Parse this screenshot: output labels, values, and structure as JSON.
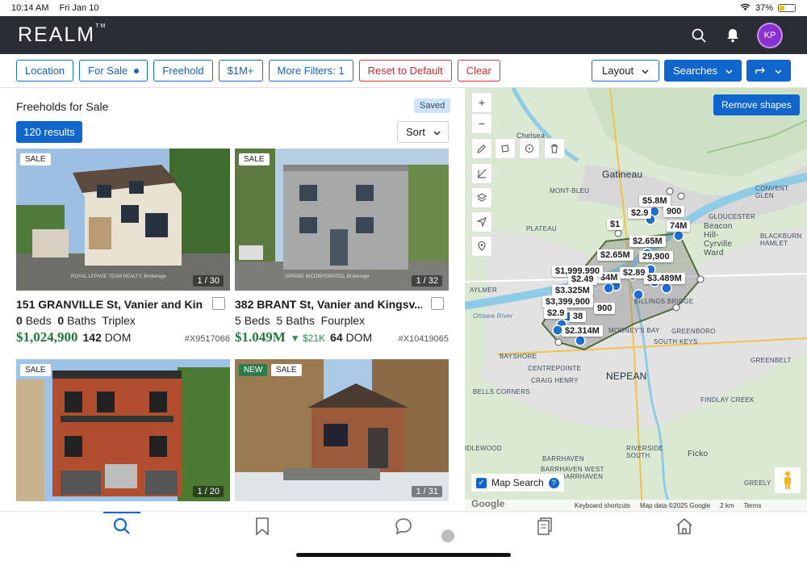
{
  "status": {
    "time": "10:14 AM",
    "date": "Fri Jan 10",
    "battery": "37%"
  },
  "header": {
    "logo": "REALM",
    "avatar_initials": "KP"
  },
  "filters": {
    "chips": [
      "Location",
      "For Sale",
      "Freehold",
      "$1M+",
      "More Filters: 1"
    ],
    "reset": "Reset to Default",
    "clear": "Clear",
    "layout": "Layout",
    "searches": "Searches"
  },
  "list": {
    "title": "Freeholds for Sale",
    "saved": "Saved",
    "results": "120 results",
    "sort": "Sort",
    "cards": [
      {
        "tag": "SALE",
        "counter": "1 / 30",
        "watermark": "ROYAL LEPAGE TEAM REALTY, Brokerage",
        "address": "151 GRANVILLE St, Vanier and Kin...",
        "beds": "0",
        "baths": "0",
        "type": "Triplex",
        "price": "$1,024,900",
        "change": "",
        "dom": "142",
        "mls": "#X9517066"
      },
      {
        "tag": "SALE",
        "counter": "1 / 32",
        "watermark": "UPPABE INCORPORATED, Brokerage",
        "address": "382 BRANT St, Vanier and Kingsv...",
        "beds": "5",
        "baths": "5",
        "type": "Fourplex",
        "price": "$1.049M",
        "change": "▼ $21K",
        "dom": "64",
        "mls": "#X10419065"
      },
      {
        "tag": "SALE",
        "counter": "1 / 20"
      },
      {
        "tag_new": "NEW",
        "tag": "SALE",
        "counter": "1 / 31"
      }
    ],
    "labels": {
      "beds": "Beds",
      "baths": "Baths",
      "dom": "DOM"
    }
  },
  "map": {
    "remove_shapes": "Remove shapes",
    "map_search": "Map Search",
    "footer": {
      "shortcuts": "Keyboard shortcuts",
      "data": "Map data ©2025 Google",
      "scale": "2 km",
      "terms": "Terms"
    },
    "places": {
      "gatineau": "Gatineau",
      "chelsea": "Chelsea",
      "mont_bleu": "MONT-BLEU",
      "plateau": "PLATEAU",
      "aylmer": "AYLMER",
      "bayshore": "BAYSHORE",
      "centrepointe": "CENTREPOINTE",
      "craig_henry": "CRAIG HENRY",
      "nepean": "NEPEAN",
      "bells_corners": "BELLS CORNERS",
      "barrhaven": "BARRHAVEN",
      "riverside": "RIVERSIDE SOUTH",
      "ficko": "Ficko",
      "greely": "GREELY",
      "findlay": "FINDLAY CREEK",
      "greenbelt": "GREENBELT",
      "greenboro": "GREENBORO",
      "south_keys": "SOUTH KEYS",
      "mooneys_bay": "MOONEY'S BAY",
      "gloucester": "GLOUCESTER",
      "beacon_hill": "Beacon Hill-Cyrville Ward",
      "blackburn": "BLACKBURN HAMLET",
      "convent": "CONVENT GLEN",
      "ottawa_river": "Ottawa River",
      "idlewood": "IDLEWOOD",
      "billings": "BILLINGS BRIDGE",
      "barrhaven_west": "BARRHAVEN WEST - OLD BARRHAVEN"
    },
    "prices": [
      "$5.8M",
      "$2.9",
      "900",
      "74M",
      "$1",
      "$2.65M",
      "$2.65M",
      "29,900",
      "$4M",
      "$2.89",
      "$3.489M",
      "$1,999,990",
      "$2.49",
      "$3.325M",
      "$3,399,900",
      "900",
      "$2.314M",
      "$2.9",
      "38"
    ]
  },
  "colors": {
    "accent": "#1166cc",
    "header_bg": "#2b2d35",
    "price_green": "#207a3f",
    "reset_red": "#d9353a"
  }
}
